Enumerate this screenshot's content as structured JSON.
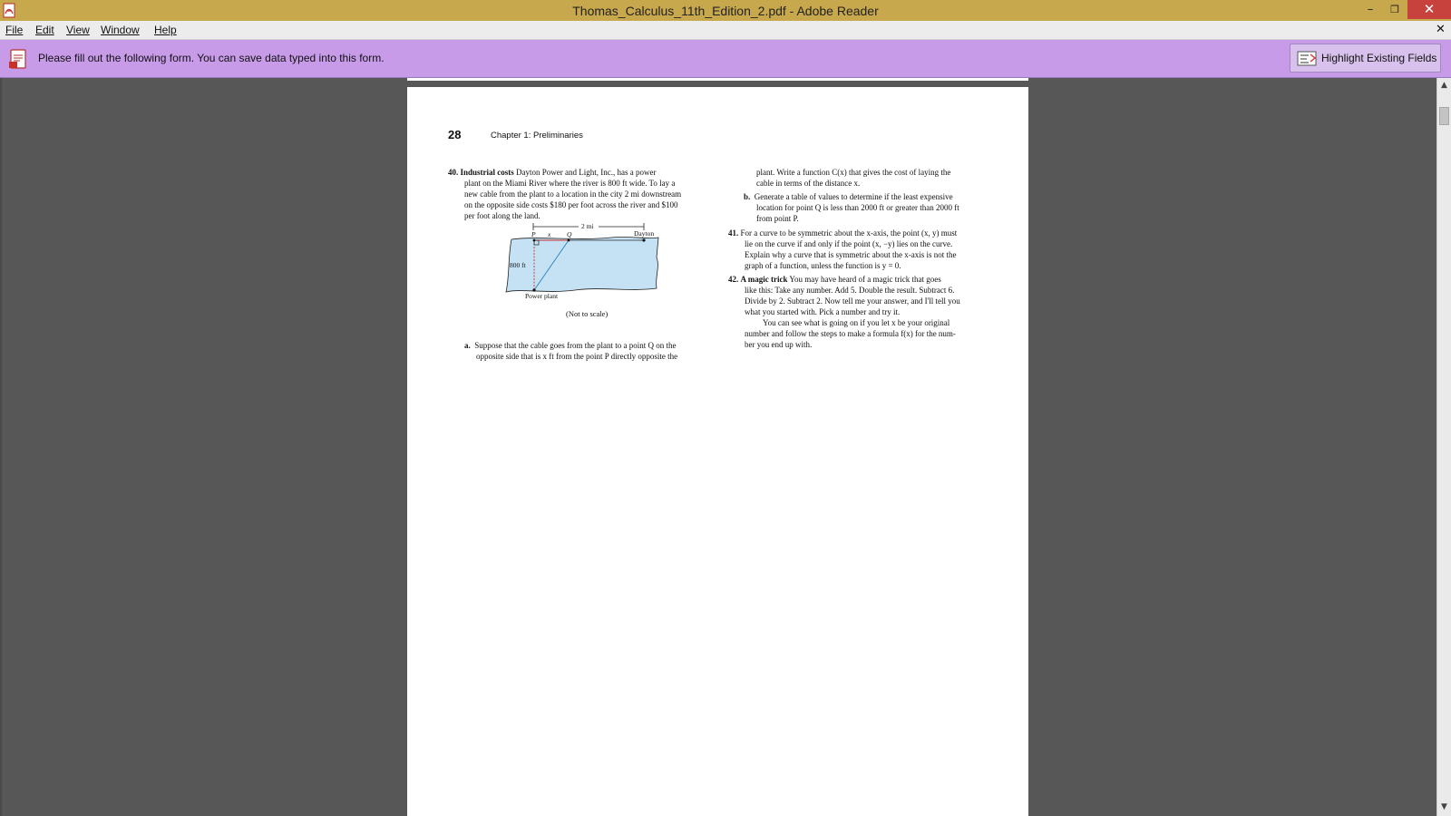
{
  "window": {
    "title": "Thomas_Calculus_11th_Edition_2.pdf - Adobe Reader",
    "controls": {
      "minimize": "–",
      "restore": "❐",
      "close": "✕"
    }
  },
  "menu": {
    "file": "File",
    "edit": "Edit",
    "view": "View",
    "window": "Window",
    "help": "Help",
    "doc_close": "✕"
  },
  "form_bar": {
    "message": "Please fill out the following form. You can save data typed into this form.",
    "highlight_button": "Highlight Existing Fields",
    "background_color": "#c89be9"
  },
  "scrollbar": {
    "up_arrow": "▲",
    "down_arrow": "▼"
  },
  "page": {
    "number": "28",
    "chapter": "Chapter 1: Preliminaries",
    "left_column": {
      "ex40_number": "40.",
      "ex40_title": "Industrial costs",
      "ex40_lines": [
        "Dayton Power and Light, Inc., has a power",
        "plant on the Miami River where the river is 800 ft wide. To lay a",
        "new cable from the plant to a location in the city 2 mi downstream",
        "on the opposite side costs $180 per foot across the river and $100",
        "per foot along the land."
      ],
      "figure": {
        "distance_label": "2 mi",
        "label_p": "P",
        "label_x": "x",
        "label_q": "Q",
        "label_dayton": "Dayton",
        "label_width": "800 ft",
        "label_plant": "Power plant",
        "caption": "(Not to scale)"
      },
      "part_a_label": "a.",
      "part_a_lines": [
        "Suppose that the cable goes from the plant to a point Q on the",
        "opposite side that is x ft from the point P directly opposite the"
      ]
    },
    "right_column": {
      "cont_lines": [
        "plant. Write a function C(x) that gives the cost of laying the",
        "cable in terms of the distance x."
      ],
      "part_b_label": "b.",
      "part_b_lines": [
        "Generate a table of values to determine if the least expensive",
        "location for point Q is less than 2000 ft or greater than 2000 ft",
        "from point P."
      ],
      "ex41_number": "41.",
      "ex41_lines": [
        "For a curve to be symmetric about the x-axis, the point (x, y) must",
        "lie on the curve if and only if the point (x, −y) lies on the curve.",
        "Explain why a curve that is symmetric about the x-axis is not the",
        "graph of a function, unless the function is y = 0."
      ],
      "ex42_number": "42.",
      "ex42_title": "A magic trick",
      "ex42_lines": [
        "You may have heard of a magic trick that goes",
        "like this: Take any number. Add 5. Double the result. Subtract 6.",
        "Divide by 2. Subtract 2. Now tell me your answer, and I'll tell you",
        "what you started with. Pick a number and try it.",
        "You can see what is going on if you let x be your original",
        "number and follow the steps to make a formula f(x) for the num-",
        "ber you end up with."
      ]
    }
  }
}
